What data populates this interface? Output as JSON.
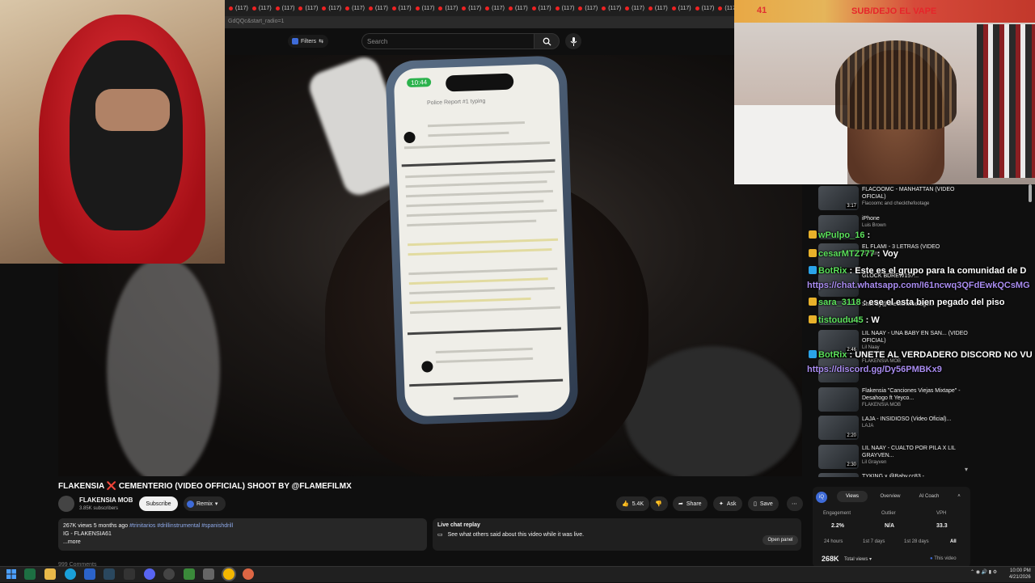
{
  "browser": {
    "tab_label": "(117)",
    "tab_count": 26,
    "url_fragment": "GdQQc&start_radio=1"
  },
  "youtube": {
    "filters_label": "Filters",
    "search_placeholder": "Search"
  },
  "phone": {
    "time": "10:44",
    "title": "Police Report #1 typing"
  },
  "overlays": {
    "viewer_count": "41",
    "stream_title": "SUB/DEJO EL VAPE"
  },
  "recommendations": [
    {
      "title": "FLACOOMC - MANHATTAN (VIDEO OFICIAL)",
      "channel": "Flacoomc and checkthefootage",
      "duration": "3:17"
    },
    {
      "title": "iPhone",
      "channel": "Luis Brown",
      "duration": ""
    },
    {
      "title": "EL FLAMI - 3 LETRAS (VIDEO",
      "channel": "El Flami",
      "duration": ""
    },
    {
      "title": "GLOCK BDREW157...",
      "channel": "",
      "duration": ""
    },
    {
      "title": "Shot By@checkthefootage...",
      "channel": "",
      "duration": "3:56"
    },
    {
      "title": "LIL NAAY - UNA BABY EN SAN... (VIDEO OFICIAL)",
      "channel": "Lil Naay",
      "duration": "2:46"
    },
    {
      "title": "",
      "channel": "FLAKENSIA MOB",
      "duration": ""
    },
    {
      "title": "Flakensia \"Canciones Viejas Mixtape\" - Desahogo ft Yeyco...",
      "channel": "FLAKENSIA MOB",
      "duration": ""
    },
    {
      "title": "LAJA - INSIDIOSO (Video Oficial)...",
      "channel": "LAJA",
      "duration": "2:20"
    },
    {
      "title": "LIL NAAY - CUALTO POR PILA X LIL GRAYVEN...",
      "channel": "Lil Grayven",
      "duration": "2:30"
    },
    {
      "title": "TYKING x @Baby.cc83 -",
      "channel": "",
      "duration": ""
    }
  ],
  "chat": [
    {
      "user": "wPulpo_16",
      "sep": " : ",
      "msg": "",
      "link": ""
    },
    {
      "user": "cesarMTZ777",
      "sep": " : ",
      "msg": "Voy",
      "link": ""
    },
    {
      "user": "BotRix",
      "sep": " : ",
      "msg": "Este es el grupo para la comunidad de D",
      "link": ""
    },
    {
      "user": "",
      "sep": "",
      "msg": "",
      "link": "https://chat.whatsapp.com/I61ncwq3QFdEwkQCsMG"
    },
    {
      "user": "sara_3118",
      "sep": " : ",
      "msg": "ese el esta bien pegado del piso",
      "link": ""
    },
    {
      "user": "tistoudu45",
      "sep": " : ",
      "msg": "W",
      "link": ""
    },
    {
      "user": "BotRix",
      "sep": " : ",
      "msg": "UNETE AL VERDADERO DISCORD NO VU",
      "link": ""
    },
    {
      "user": "",
      "sep": "",
      "msg": "",
      "link": "https://discord.gg/Dy56PMBKx9"
    }
  ],
  "video": {
    "title_a": "FLAKENSIA ",
    "title_x": "❌",
    "title_b": " CEMENTERIO (VIDEO OFFICIAL) SHOOT BY @FLAMEFILMX",
    "channel": "FLAKENSIA MOB",
    "subs": "3.85K subscribers",
    "subscribe": "Subscribe",
    "remix": "Remix",
    "likes": "5.4K",
    "share": "Share",
    "ask": "Ask",
    "save": "Save",
    "desc_views": "267K views  5 months ago",
    "desc_tags": "#trinitarios #drillinstrumental #spanishdrill",
    "desc_line2": "IG - FLAKENSIA61",
    "desc_more": "...more",
    "livechat_title": "Live chat replay",
    "livechat_desc": "See what others said about this video while it was live.",
    "open_panel": "Open panel",
    "comments_stub": "999 Comments"
  },
  "analytics": {
    "tabs": [
      "Views",
      "Overview",
      "AI Coach"
    ],
    "labels": [
      "Engagement",
      "Outlier",
      "VPH"
    ],
    "values": [
      "2.2%",
      "N/A",
      "33.3"
    ],
    "ranges": [
      "24 hours",
      "1st 7 days",
      "1st 28 days",
      "All"
    ],
    "total": "268K",
    "total_label": "Total views",
    "this_video": "This video"
  },
  "clock": {
    "time": "10:00 PM",
    "date": "4/21/2026"
  },
  "colors": {
    "accent": "#3e6bd8",
    "chat_user": "#5ce05c",
    "chat_link": "#a98cf0",
    "stream_title": "#e6252a"
  }
}
